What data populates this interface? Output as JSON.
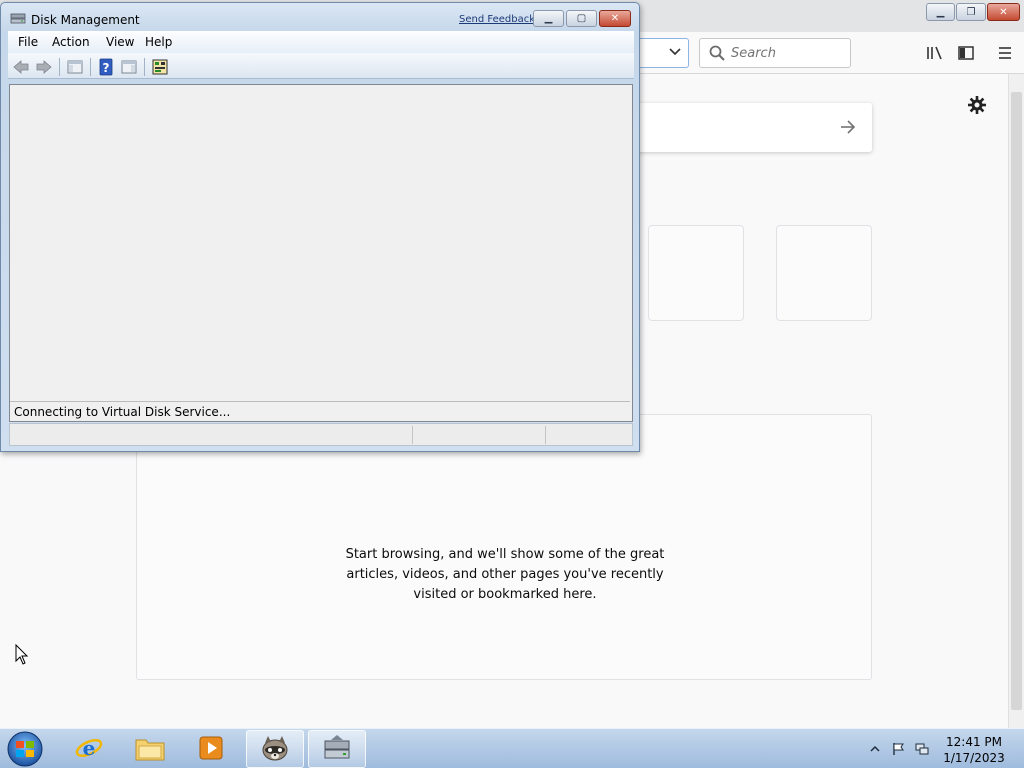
{
  "firefox": {
    "search_placeholder": "Search",
    "highlights_message": "Start browsing, and we'll show some of the great articles, videos, and other pages you've recently visited or bookmarked here."
  },
  "disk_management": {
    "title": "Disk Management",
    "send_feedback": "Send Feedback",
    "menus": [
      "File",
      "Action",
      "View",
      "Help"
    ],
    "status": "Connecting to Virtual Disk Service..."
  },
  "taskbar": {
    "time": "12:41 PM",
    "date": "1/17/2023"
  },
  "colors": {
    "taskbar": "#b5cce6",
    "window_frame": "#c5d7ea",
    "close_button": "#c44a32"
  }
}
